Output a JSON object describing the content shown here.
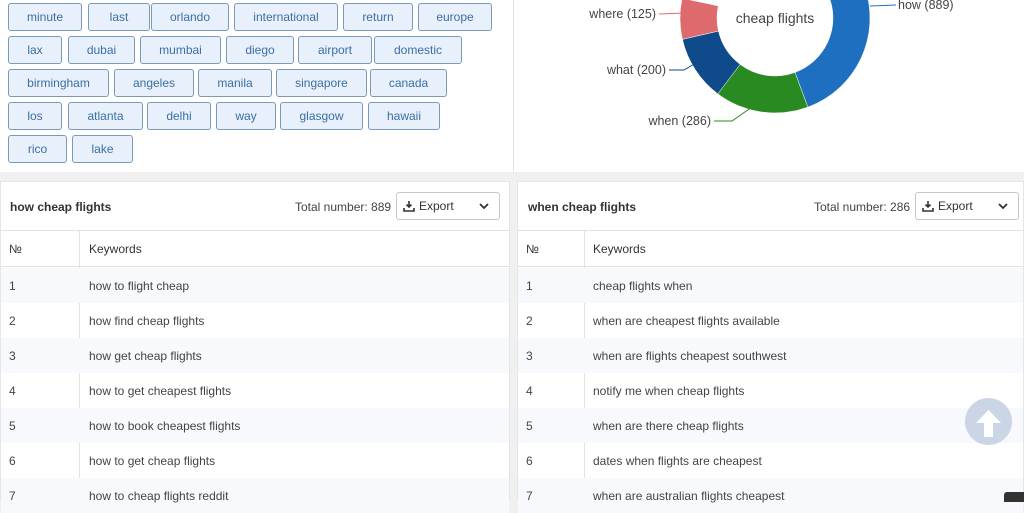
{
  "tags": [
    "minute",
    "last",
    "orlando",
    "international",
    "return",
    "europe",
    "lax",
    "dubai",
    "mumbai",
    "diego",
    "airport",
    "domestic",
    "birmingham",
    "angeles",
    "manila",
    "singapore",
    "canada",
    "los",
    "atlanta",
    "delhi",
    "way",
    "glasgow",
    "hawaii",
    "rico",
    "lake"
  ],
  "chart_data": {
    "type": "pie",
    "title": "cheap flights",
    "center_label": "cheap flights",
    "slices": [
      {
        "label": "how",
        "value": 889,
        "display": "how (889)",
        "color": "#1f6fc0"
      },
      {
        "label": "when",
        "value": 286,
        "display": "when (286)",
        "color": "#2a8a22"
      },
      {
        "label": "what",
        "value": 200,
        "display": "what (200)",
        "color": "#0f4a8a"
      },
      {
        "label": "where",
        "value": 125,
        "display": "where (125)",
        "color": "#de6a6e"
      }
    ]
  },
  "panels": [
    {
      "title": "how cheap flights",
      "total": "Total number: 889",
      "export_label": "Export",
      "columns": [
        "№",
        "Keywords"
      ],
      "rows": [
        [
          "1",
          "how to flight cheap"
        ],
        [
          "2",
          "how find cheap flights"
        ],
        [
          "3",
          "how get cheap flights"
        ],
        [
          "4",
          "how to get cheapest flights"
        ],
        [
          "5",
          "how to book cheapest flights"
        ],
        [
          "6",
          "how to get cheap flights"
        ],
        [
          "7",
          "how to cheap flights reddit"
        ]
      ]
    },
    {
      "title": "when cheap flights",
      "total": "Total number: 286",
      "export_label": "Export",
      "columns": [
        "№",
        "Keywords"
      ],
      "rows": [
        [
          "1",
          "cheap flights when"
        ],
        [
          "2",
          "when are cheapest flights available"
        ],
        [
          "3",
          "when are flights cheapest southwest"
        ],
        [
          "4",
          "notify me when cheap flights"
        ],
        [
          "5",
          "when are there cheap flights"
        ],
        [
          "6",
          "dates when flights are cheapest"
        ],
        [
          "7",
          "when are australian flights cheapest"
        ]
      ]
    }
  ],
  "icons": {
    "export": "download-icon",
    "dropdown": "chevron-down-icon",
    "scroll_top": "arrow-up-icon"
  }
}
